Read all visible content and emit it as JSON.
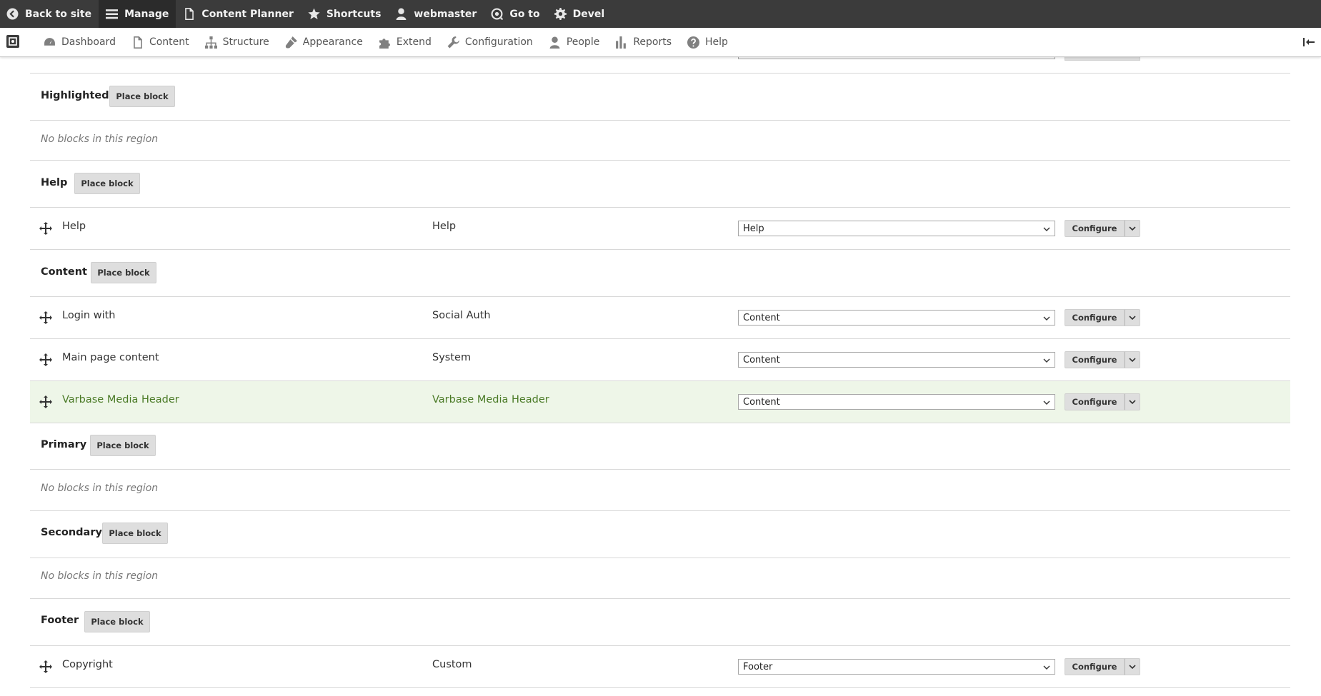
{
  "toolbar": {
    "items": [
      {
        "label": "Back to site",
        "icon": "back-icon"
      },
      {
        "label": "Manage",
        "icon": "menu-icon"
      },
      {
        "label": "Content Planner",
        "icon": "document-icon"
      },
      {
        "label": "Shortcuts",
        "icon": "star-icon"
      },
      {
        "label": "webmaster",
        "icon": "user-icon"
      },
      {
        "label": "Go to",
        "icon": "goto-icon"
      },
      {
        "label": "Devel",
        "icon": "gear-icon"
      }
    ]
  },
  "admin_menu": {
    "items": [
      {
        "label": "Dashboard",
        "icon": "dashboard-icon"
      },
      {
        "label": "Content",
        "icon": "document-icon"
      },
      {
        "label": "Structure",
        "icon": "structure-icon"
      },
      {
        "label": "Appearance",
        "icon": "brush-icon"
      },
      {
        "label": "Extend",
        "icon": "puzzle-icon"
      },
      {
        "label": "Configuration",
        "icon": "wrench-icon"
      },
      {
        "label": "People",
        "icon": "person-icon"
      },
      {
        "label": "Reports",
        "icon": "bar-chart-icon"
      },
      {
        "label": "Help",
        "icon": "help-icon"
      }
    ]
  },
  "labels": {
    "place_block": "Place block",
    "configure": "Configure",
    "no_blocks": "No blocks in this region"
  },
  "regions": {
    "highlighted": {
      "title": "Highlighted"
    },
    "help": {
      "title": "Help"
    },
    "content": {
      "title": "Content"
    },
    "primary": {
      "title": "Primary"
    },
    "secondary": {
      "title": "Secondary"
    },
    "footer": {
      "title": "Footer"
    }
  },
  "blocks": {
    "help": {
      "name": "Help",
      "category": "Help",
      "region": "Help"
    },
    "login": {
      "name": "Login with",
      "category": "Social Auth",
      "region": "Content"
    },
    "main": {
      "name": "Main page content",
      "category": "System",
      "region": "Content"
    },
    "media": {
      "name": "Varbase Media Header",
      "category": "Varbase Media Header",
      "region": "Content"
    },
    "copyright": {
      "name": "Copyright",
      "category": "Custom",
      "region": "Footer"
    }
  },
  "colors": {
    "toolbar_bg": "#3b3b3b",
    "highlight_row": "#eef6e8",
    "highlight_text": "#4a7a26"
  }
}
